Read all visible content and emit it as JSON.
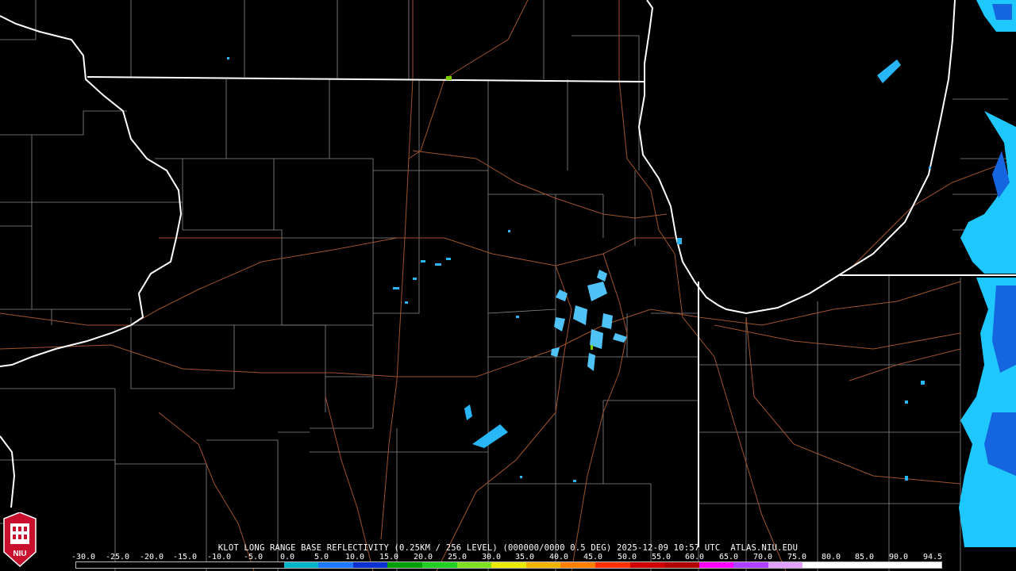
{
  "caption": {
    "station": "KLOT",
    "product": "LONG RANGE BASE REFLECTIVITY",
    "resolution": "(0.25KM / 256 LEVEL)",
    "volume": "(000000/0000 0.5 DEG)",
    "timestamp": "2025-12-09 10:57 UTC",
    "source": "ATLAS.NIU.EDU",
    "full": "KLOT LONG RANGE BASE REFLECTIVITY (0.25KM / 256 LEVEL) (000000/0000 0.5 DEG) 2025-12-09 10:57 UTC  ATLAS.NIU.EDU"
  },
  "scale": {
    "labels": [
      "-30.0",
      "-25.0",
      "-20.0",
      "-15.0",
      "-10.0",
      "-5.0",
      "0.0",
      "5.0",
      "10.0",
      "15.0",
      "20.0",
      "25.0",
      "30.0",
      "35.0",
      "40.0",
      "45.0",
      "50.0",
      "55.0",
      "60.0",
      "65.0",
      "70.0",
      "75.0",
      "80.0",
      "85.0",
      "90.0",
      "94.5"
    ],
    "colors": [
      "#000000",
      "#000000",
      "#000000",
      "#000000",
      "#000000",
      "#000000",
      "#00b4c8",
      "#1e78ff",
      "#0a30d0",
      "#00a000",
      "#22ce22",
      "#7de020",
      "#e8e800",
      "#f0b400",
      "#ff8000",
      "#ff3000",
      "#d00000",
      "#b00000",
      "#ff00ff",
      "#b040ff",
      "#e0a0ff",
      "#ffffff",
      "#ffffff",
      "#ffffff",
      "#ffffff"
    ]
  },
  "logo": {
    "text": "NIU"
  },
  "map": {
    "background": "#000000",
    "state_line_color": "#ffffff",
    "county_line_color": "#9a9a9a",
    "highway_color": "#a0522d",
    "echo_colors": [
      "#00c8ff",
      "#1e90ff",
      "#0050e0",
      "#7fd000"
    ]
  }
}
